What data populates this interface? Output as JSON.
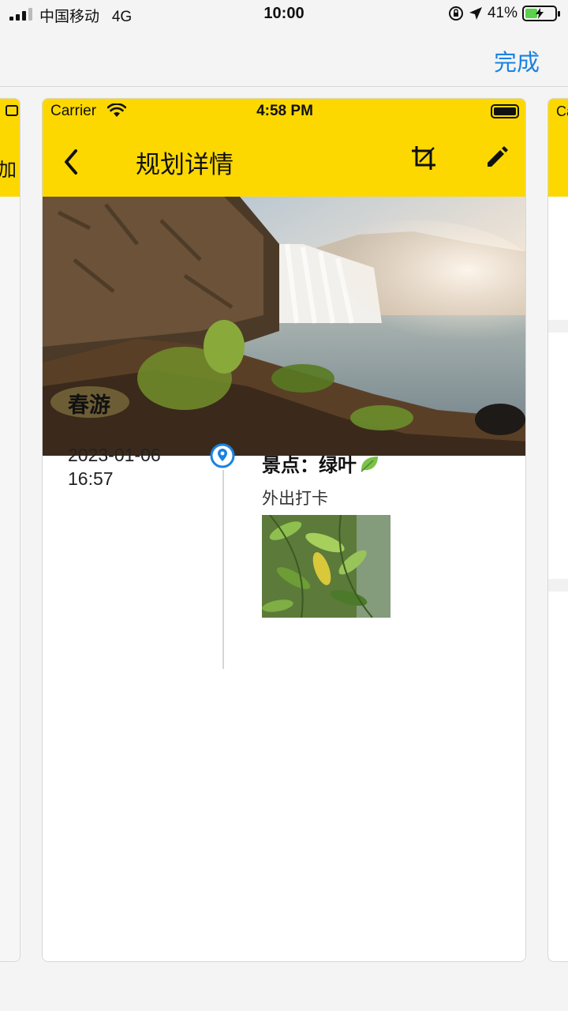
{
  "os_status": {
    "carrier": "中国移动",
    "network": "4G",
    "time": "10:00",
    "battery_percent": "41%",
    "battery_level": 0.41
  },
  "outer_nav": {
    "done_label": "完成"
  },
  "side_cards": {
    "left_peek_text": "加",
    "right_peek_text": "Ca"
  },
  "card": {
    "inner_status": {
      "carrier": "Carrier",
      "time": "4:58 PM"
    },
    "nav": {
      "title": "规划详情",
      "back_icon": "chevron-left-icon",
      "crop_icon": "crop-icon",
      "edit_icon": "pencil-icon"
    },
    "header_color": "#fcd800",
    "plan": {
      "title": "春游",
      "date": "2023-01-06",
      "time": "16:57",
      "spot_title": "景点：绿叶",
      "spot_desc": "外出打卡"
    }
  },
  "colors": {
    "accent": "#1a82e2",
    "header_yellow": "#fcd800"
  }
}
